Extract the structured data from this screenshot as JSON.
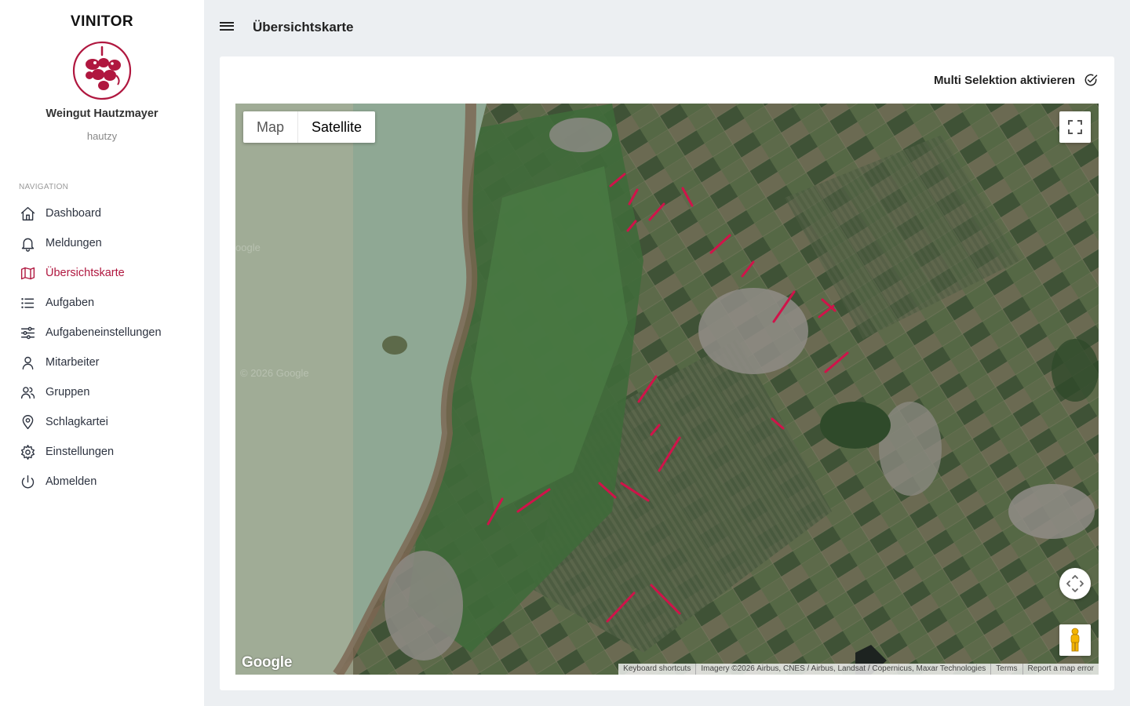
{
  "sidebar": {
    "brand": "VINITOR",
    "company": "Weingut Hautzmayer",
    "username": "hautzy",
    "nav_heading": "NAVIGATION",
    "items": [
      {
        "label": "Dashboard",
        "icon": "home-icon"
      },
      {
        "label": "Meldungen",
        "icon": "bell-icon"
      },
      {
        "label": "Übersichtskarte",
        "icon": "map-icon",
        "active": true
      },
      {
        "label": "Aufgaben",
        "icon": "list-icon"
      },
      {
        "label": "Aufgabeneinstellungen",
        "icon": "sliders-icon"
      },
      {
        "label": "Mitarbeiter",
        "icon": "user-icon"
      },
      {
        "label": "Gruppen",
        "icon": "users-icon"
      },
      {
        "label": "Schlagkartei",
        "icon": "map-pin-icon"
      },
      {
        "label": "Einstellungen",
        "icon": "gear-icon"
      },
      {
        "label": "Abmelden",
        "icon": "power-icon"
      }
    ]
  },
  "header": {
    "title": "Übersichtskarte"
  },
  "main": {
    "multi_select_label": "Multi Selektion aktivieren"
  },
  "map": {
    "type_map": "Map",
    "type_satellite": "Satellite",
    "selected_type": "Satellite",
    "google_logo": "Google",
    "watermark": "© 2026 Google",
    "attribution": {
      "shortcuts": "Keyboard shortcuts",
      "imagery": "Imagery ©2026 Airbus, CNES / Airbus, Landsat / Copernicus, Maxar Technologies",
      "terms": "Terms",
      "report": "Report a map error"
    }
  },
  "colors": {
    "accent": "#b0173f",
    "background": "#eceff2",
    "lake": "#8fa894",
    "field_highlight": "#d0134a"
  }
}
